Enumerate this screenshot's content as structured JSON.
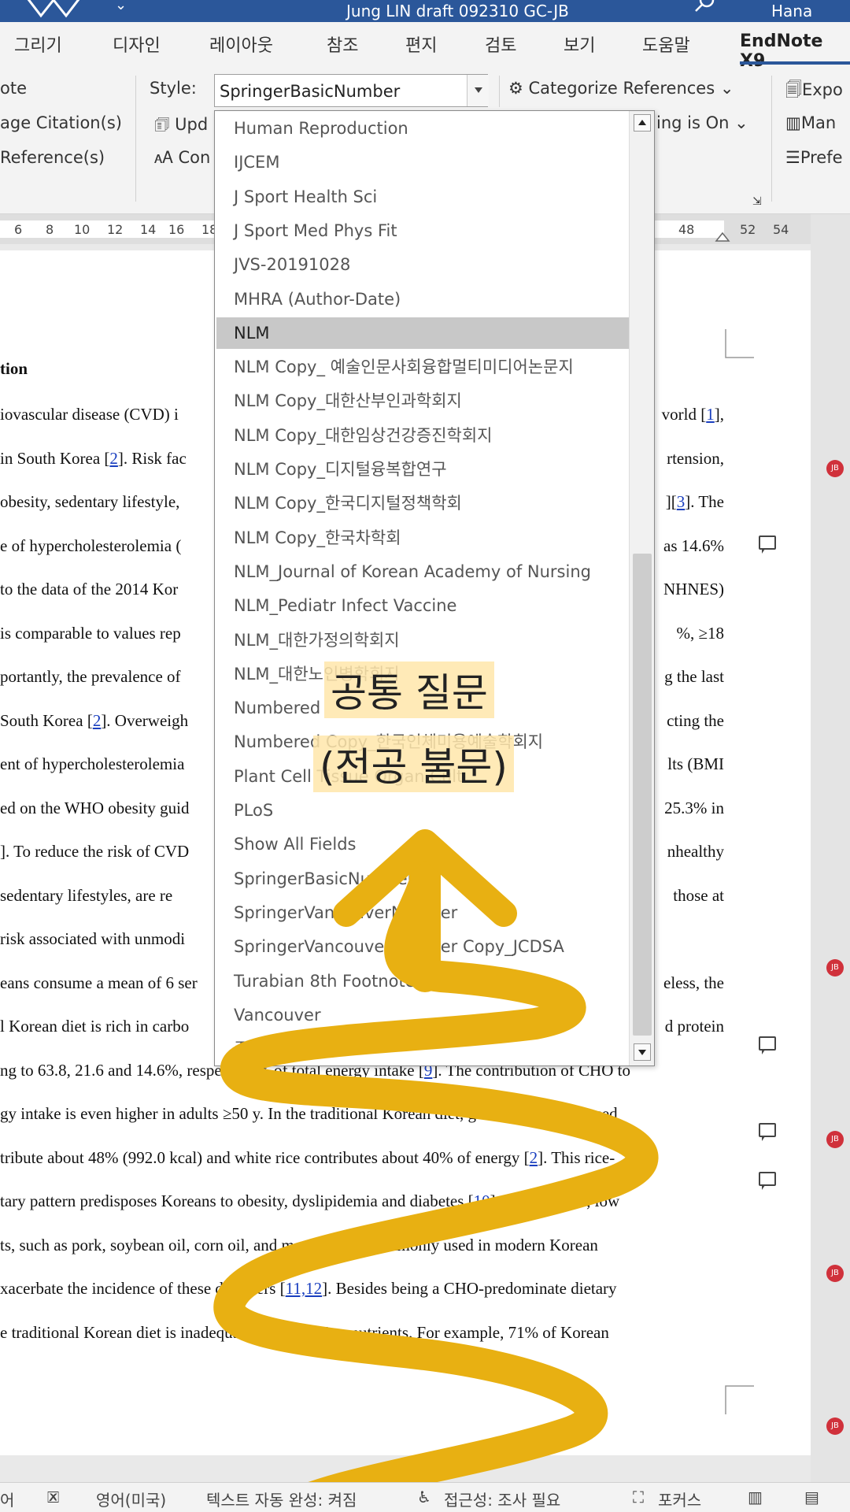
{
  "title_bar": {
    "doc_title": "Jung LIN draft 092310 GC-JB",
    "user": "Hana Jung"
  },
  "ribbon_tabs": [
    {
      "label": "그리기"
    },
    {
      "label": "디자인"
    },
    {
      "label": "레이아웃"
    },
    {
      "label": "참조"
    },
    {
      "label": "편지"
    },
    {
      "label": "검토"
    },
    {
      "label": "보기"
    },
    {
      "label": "도움말"
    },
    {
      "label": "EndNote X9",
      "active": true
    }
  ],
  "ribbon": {
    "left_group": [
      "ote",
      "age Citation(s)",
      "Reference(s)"
    ],
    "style_label": "Style:",
    "style_value": "SpringerBasicNumber",
    "update_label": "Upd",
    "convert_label": "Con",
    "categorize_label": "Categorize References",
    "instant_formatting_label": "ing is On",
    "right_group": [
      "Expo",
      "Man",
      "Prefe"
    ]
  },
  "ruler_numbers": [
    "6",
    "8",
    "10",
    "12",
    "14",
    "16",
    "18",
    "48",
    "52",
    "54"
  ],
  "style_dropdown": {
    "items": [
      "Human Reproduction",
      "IJCEM",
      "J Sport Health Sci",
      "J Sport Med Phys Fit",
      "JVS-20191028",
      "MHRA (Author-Date)",
      "NLM",
      "NLM Copy_ 예술인문사회융합멀티미디어논문지",
      "NLM Copy_대한산부인과학회지",
      "NLM Copy_대한임상건강증진학회지",
      "NLM Copy_디지털융복합연구",
      "NLM Copy_한국디지털정책학회",
      "NLM Copy_한국차학회",
      "NLM_Journal of Korean Academy of Nursing",
      "NLM_Pediatr Infect Vaccine",
      "NLM_대한가정의학회지",
      "NLM_대한노인병학회지",
      "Numbered",
      "Numbered Copy_한국인체미용예술학회지",
      "Plant Cell Tissue Organ Cult",
      "PLoS",
      "Show All Fields",
      "SpringerBasicNumber",
      "SpringerVancouverNumber",
      "SpringerVancouverNumber Copy_JCDSA",
      "Turabian 8th Footnote",
      "Vancouver",
      "중앙의대지"
    ],
    "selected": "NLM"
  },
  "document": {
    "heading": "tion",
    "lines": [
      {
        "left": "iovascular disease (CVD) i",
        "right": "vorld [",
        "ref": "1",
        "tail": "],"
      },
      {
        "left": "in South Korea [",
        "ref_left": "2",
        "left_tail": "]. Risk fac",
        "right": "rtension,"
      },
      {
        "left": "obesity, sedentary lifestyle,",
        "right": "][",
        "ref": "3",
        "tail": "]. The"
      },
      {
        "left": "e of hypercholesterolemia (",
        "right": "as 14.6%"
      },
      {
        "left": "to the data of the 2014 Kor",
        "right": "NHNES)"
      },
      {
        "left": "is comparable to values rep",
        "right": "%,  ≥18"
      },
      {
        "left": "portantly, the prevalence of",
        "right": "g the last"
      },
      {
        "left": "South Korea [",
        "ref_left": "2",
        "left_tail": "]. Overweigh",
        "right": "cting the"
      },
      {
        "left": "ent of hypercholesterolemia",
        "right": "lts (BMI"
      },
      {
        "left": "ed on the WHO obesity guid",
        "right": "25.3% in"
      },
      {
        "left": "]. To reduce the risk of CVD",
        "right": "nhealthy"
      },
      {
        "left": "sedentary lifestyles, are re",
        "right": "those at"
      },
      {
        "left": "risk associated with unmodi",
        "right": ""
      },
      {
        "left": "eans consume a mean of 6 ser",
        "right": "eless, the"
      },
      {
        "left": "l Korean diet is rich in carbo",
        "right": "d protein"
      },
      {
        "left": "ng to 63.8, 21.6 and 14.6%, respectively, of total energy intake [",
        "ref_left": "9",
        "left_tail": "]. The contribution of CHO to",
        "right": ""
      },
      {
        "left": "gy intake is even higher in adults ≥50 y. In the traditional Korean diet, grains and grain-based",
        "right": ""
      },
      {
        "left": "tribute about 48% (992.0 kcal) and white rice contributes about 40% of energy [",
        "ref_left": "2",
        "left_tail": "]. This rice-",
        "right": ""
      },
      {
        "left": "tary pattern predisposes Koreans to obesity, dyslipidemia and diabetes [",
        "ref_left": "10",
        "left_tail": "]. Furthermore, low",
        "right": ""
      },
      {
        "left": "ts, such as pork, soybean oil, corn oil, and mayonnaise, commonly used in modern Korean",
        "right": ""
      },
      {
        "left": "xacerbate the incidence of these disorders [",
        "ref_left": "11,12",
        "left_tail": "]. Besides being a CHO-predominate dietary",
        "right": ""
      },
      {
        "left": "e traditional Korean diet is inadequate in some micronutrients. For example, 71% of Korean",
        "right": ""
      }
    ]
  },
  "overlay": {
    "line1": "공통 질문",
    "line2": "(전공 불문)",
    "arrow_color": "#e8b012"
  },
  "status_bar": {
    "items": [
      "어",
      "영어(미국)",
      "텍스트 자동 완성: 켜짐",
      "접근성: 조사 필요",
      "포커스"
    ]
  },
  "colors": {
    "word_blue": "#2b579a",
    "selected_item": "#c8c8c8",
    "link": "#1a3fbf",
    "marker_red": "#d0313b"
  }
}
